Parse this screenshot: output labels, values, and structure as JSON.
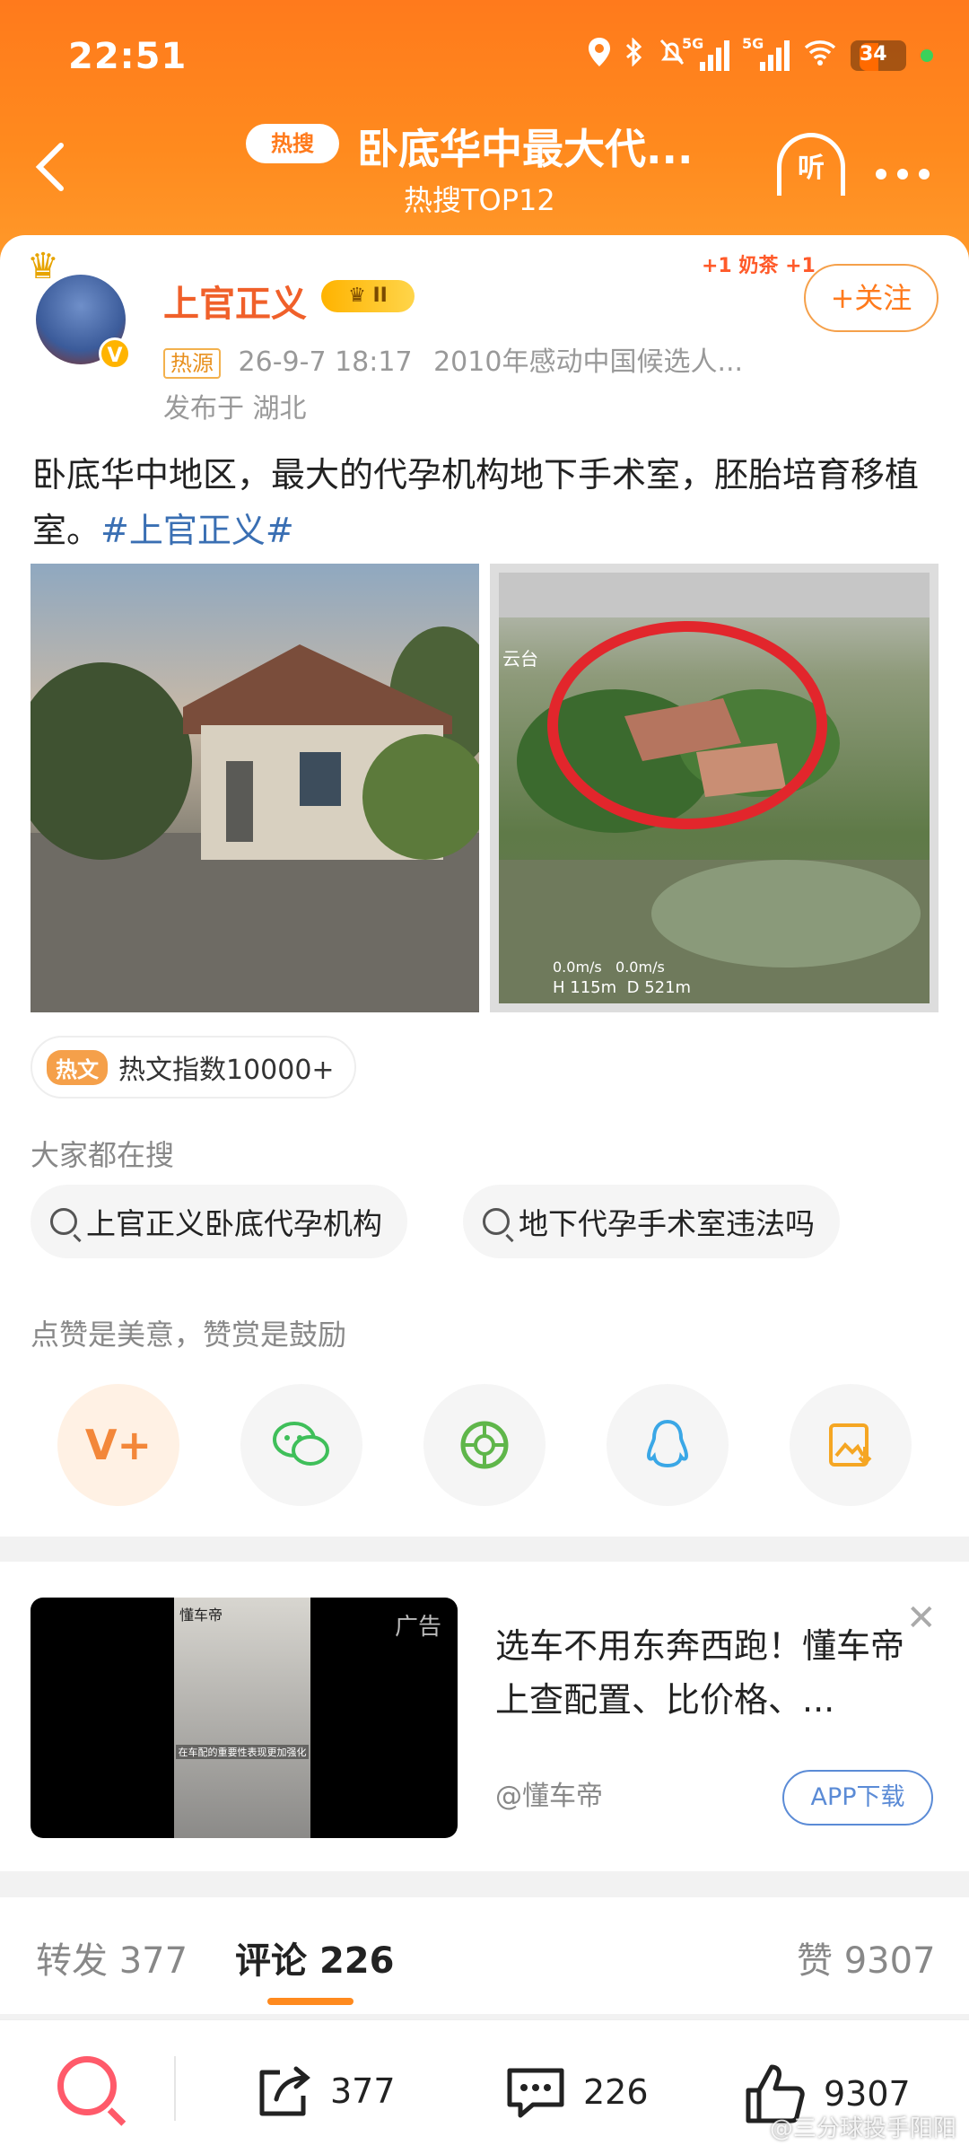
{
  "status_bar": {
    "time": "22:51",
    "network_1": "5G",
    "network_2": "5G",
    "battery": "34"
  },
  "nav": {
    "back_icon": "chevron-left",
    "hot_tag": "热搜",
    "title": "卧底华中最大代...",
    "subtitle": "热搜TOP12",
    "listen_label": "听",
    "more_icon": "more-dots"
  },
  "post": {
    "username": "上官正义",
    "level_badge": "II",
    "source_tag": "热源",
    "datetime": "26-9-7 18:17",
    "description": "2010年感动中国候选人...",
    "location": "发布于 湖北",
    "follow_label": "+关注",
    "decoration_text": "奶茶",
    "text_main": "卧底华中地区，最大的代孕机构地下手术室，胚胎培育移植室。",
    "topic": "#上官正义#",
    "image_overlay": {
      "speed_a": "0.0m/s",
      "speed_b": "0.0m/s",
      "height": "H 115m",
      "distance": "D 521m",
      "corner_label": "云台"
    },
    "hot_index_badge": "热文",
    "hot_index_text": "热文指数10000+"
  },
  "searches": {
    "heading": "大家都在搜",
    "items": [
      "上官正义卧底代孕机构",
      "地下代孕手术室违法吗"
    ]
  },
  "reward": {
    "heading": "点赞是美意，赞赏是鼓励",
    "buttons": [
      {
        "icon": "v-plus-icon",
        "glyph": "V+",
        "color": "#f3873a",
        "bg": "#fff1e4"
      },
      {
        "icon": "wechat-icon",
        "glyph": "💬",
        "color": "#3fbf5a",
        "bg": "#f5f5f5"
      },
      {
        "icon": "moments-icon",
        "glyph": "◎",
        "color": "#5fb64a",
        "bg": "#f5f5f5"
      },
      {
        "icon": "qq-icon",
        "glyph": "♟",
        "color": "#3aa7e6",
        "bg": "#f5f5f5"
      },
      {
        "icon": "save-image-icon",
        "glyph": "▣",
        "color": "#f5a623",
        "bg": "#f5f5f5"
      }
    ]
  },
  "ad": {
    "tag": "广告",
    "brand": "懂车帝",
    "caption": "在车配的重要性表现更加强化",
    "text": "选车不用东奔西跑！懂车帝上查配置、比价格、...",
    "account": "@懂车帝",
    "button": "APP下载"
  },
  "tabs": {
    "repost_label": "转发",
    "repost_count": "377",
    "comment_label": "评论",
    "comment_count": "226",
    "like_label": "赞",
    "like_count": "9307"
  },
  "bottom_bar": {
    "share_count": "377",
    "comment_count": "226",
    "like_count": "9307"
  },
  "watermark": "@三分球投手阳阳",
  "colors": {
    "brand_orange": "#ff7a1c",
    "username": "#f0602a",
    "topic_blue": "#3a6fb3"
  }
}
